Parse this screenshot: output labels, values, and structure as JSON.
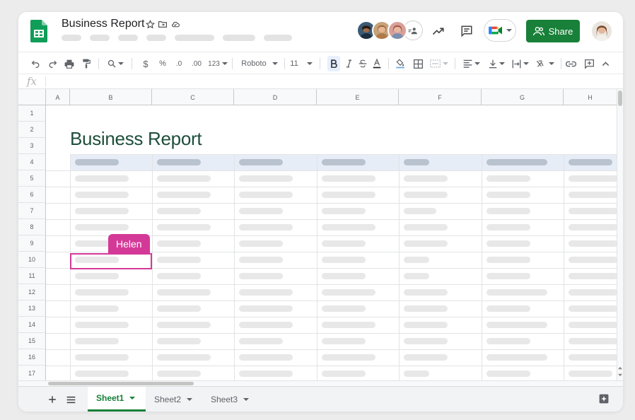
{
  "app": {
    "doc_title": "Business Report",
    "share_label": "Share",
    "colors": {
      "brand_green": "#188038",
      "collaborator": "#d43997",
      "title_green": "#1e4e3c",
      "header_band": "#e7edf7"
    }
  },
  "title_bar": {
    "icons": [
      "star-icon",
      "move-folder-icon",
      "cloud-status-icon"
    ],
    "right_icons": [
      "activity-trend-icon",
      "comment-icon",
      "meet-icon",
      "share-people-icon"
    ]
  },
  "toolbar": {
    "font_name": "Roboto",
    "font_size": "11",
    "currency": "$",
    "percent": "%",
    "decrease_decimal": ".0",
    "increase_decimal": ".00",
    "number_format": "123"
  },
  "formula_bar": {
    "fx_label": "fx"
  },
  "grid": {
    "columns": [
      "A",
      "B",
      "C",
      "D",
      "E",
      "F",
      "G",
      "H"
    ],
    "rows": [
      "1",
      "2",
      "3",
      "4",
      "5",
      "6",
      "7",
      "8",
      "9",
      "10",
      "11",
      "12",
      "13",
      "14",
      "15",
      "16",
      "17"
    ],
    "sheet_title": "Business Report"
  },
  "collaborator": {
    "name": "Helen"
  },
  "sheets": {
    "tabs": [
      {
        "label": "Sheet1",
        "active": true
      },
      {
        "label": "Sheet2",
        "active": false
      },
      {
        "label": "Sheet3",
        "active": false
      }
    ]
  }
}
